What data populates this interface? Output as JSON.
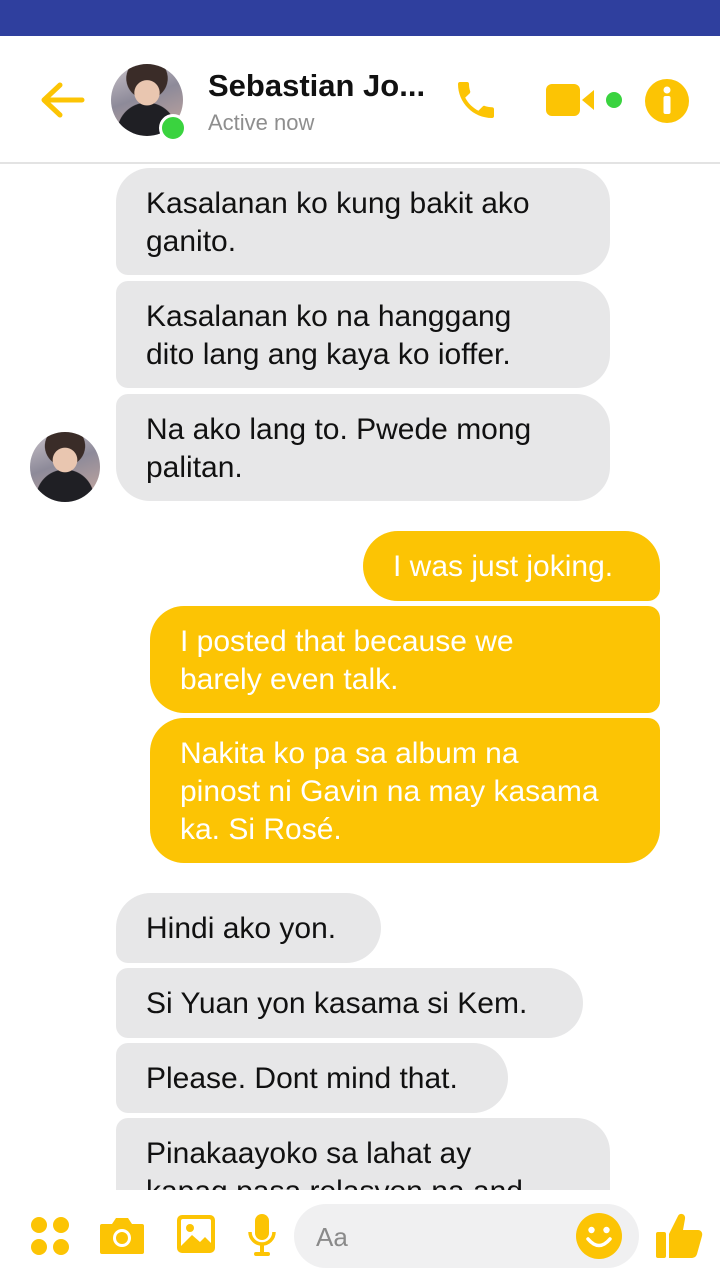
{
  "header": {
    "contact_name": "Sebastian Jo...",
    "status": "Active now",
    "icons": [
      "back-arrow-icon",
      "phone-icon",
      "video-camera-icon",
      "info-icon"
    ],
    "accent_color": "#fcc404",
    "online_color": "#3ad33f"
  },
  "messages": [
    {
      "side": "received",
      "text": "Kasalanan ko kung bakit ako\nganito."
    },
    {
      "side": "received",
      "text": "Kasalanan ko na hanggang\ndito lang ang kaya ko ioffer."
    },
    {
      "side": "received",
      "text": "Na ako lang to. Pwede mong\npalitan."
    },
    {
      "side": "sent",
      "text": "I was just joking."
    },
    {
      "side": "sent",
      "text": "I posted that because we\nbarely even talk."
    },
    {
      "side": "sent",
      "text": "Nakita ko pa sa album na\npinost ni Gavin na may kasama\nka. Si Rosé."
    },
    {
      "side": "received",
      "text": "Hindi ako yon."
    },
    {
      "side": "received",
      "text": "Si Yuan yon kasama si Kem."
    },
    {
      "side": "received",
      "text": "Please. Dont mind that."
    },
    {
      "side": "received",
      "text": "Pinakaayoko sa lahat ay\nkapag pasa relasyon na and"
    }
  ],
  "composer": {
    "placeholder": "Aa",
    "icons": [
      "apps-icon",
      "camera-icon",
      "image-icon",
      "microphone-icon",
      "emoji-icon",
      "thumbs-up-icon"
    ]
  }
}
